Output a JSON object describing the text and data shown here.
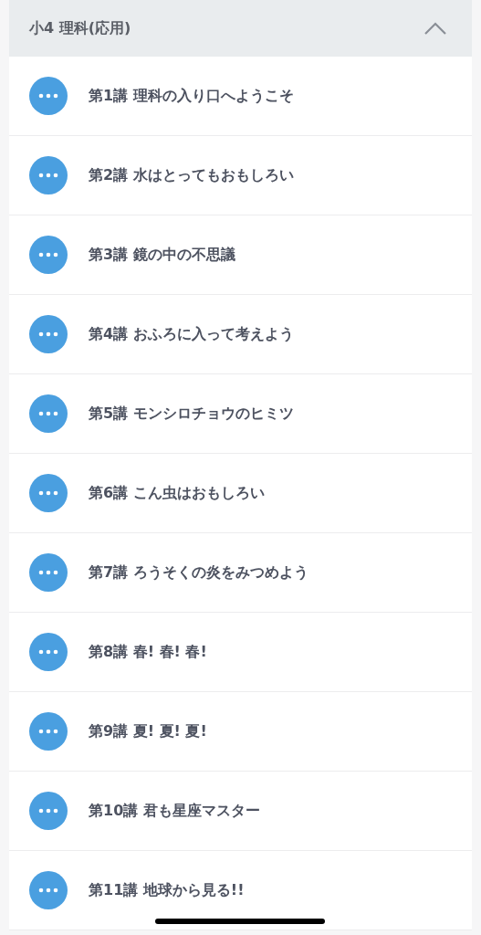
{
  "section": {
    "title": "小4 理科(応用)",
    "expanded": true,
    "lessons": [
      {
        "title": "第1講 理科の入り口へようこそ"
      },
      {
        "title": "第2講 水はとってもおもしろい"
      },
      {
        "title": "第3講 鏡の中の不思議"
      },
      {
        "title": "第4講 おふろに入って考えよう"
      },
      {
        "title": "第5講 モンシロチョウのヒミツ"
      },
      {
        "title": "第6講 こん虫はおもしろい"
      },
      {
        "title": "第7講 ろうそくの炎をみつめよう"
      },
      {
        "title": "第8講 春! 春! 春!"
      },
      {
        "title": "第9講 夏! 夏! 夏!"
      },
      {
        "title": "第10講 君も星座マスター"
      },
      {
        "title": "第11講 地球から見る!!"
      }
    ]
  }
}
